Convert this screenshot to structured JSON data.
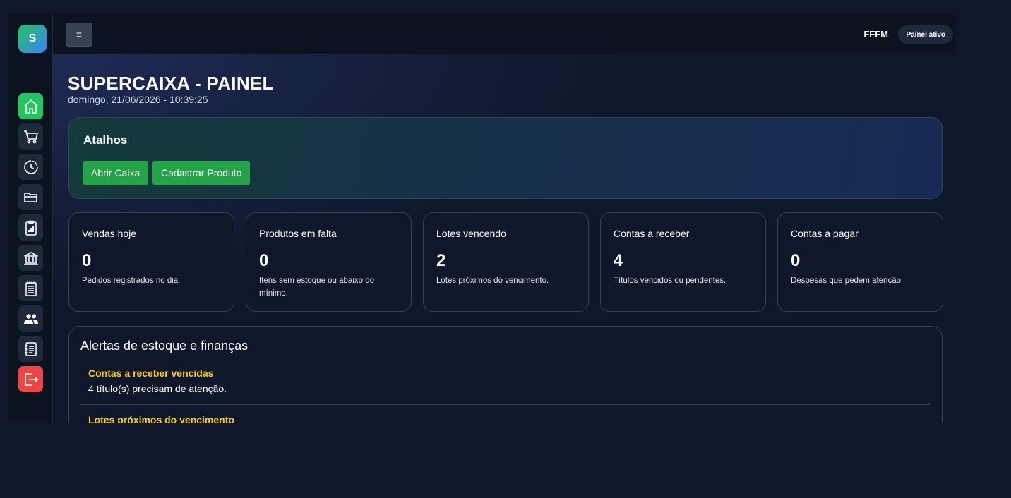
{
  "sidebar": {
    "logo_letter": "S",
    "items": [
      {
        "name": "home",
        "icon": "home-icon"
      },
      {
        "name": "cart",
        "icon": "cart-icon"
      },
      {
        "name": "history",
        "icon": "clock-icon"
      },
      {
        "name": "folder",
        "icon": "folder-icon"
      },
      {
        "name": "reports",
        "icon": "clipboard-chart-icon"
      },
      {
        "name": "bank",
        "icon": "bank-icon"
      },
      {
        "name": "notes",
        "icon": "notepad-icon"
      },
      {
        "name": "users",
        "icon": "users-icon"
      },
      {
        "name": "journal",
        "icon": "journal-icon"
      },
      {
        "name": "logout",
        "icon": "logout-icon"
      }
    ],
    "colors": {
      "active": "#22c55e",
      "logout": "#ef4444",
      "default": "#1e293b"
    }
  },
  "topbar": {
    "menu_icon": "≡",
    "user": "FFFM",
    "status": "Painel ativo"
  },
  "page": {
    "title": "SUPERCAIXA - PAINEL",
    "datetime": "domingo, 21/06/2026 - 10:39:25"
  },
  "shortcuts": {
    "title": "Atalhos",
    "open_cash_label": "Abrir Caixa",
    "register_product_label": "Cadastrar Produto"
  },
  "cards": [
    {
      "title": "Vendas hoje",
      "value": "0",
      "desc": "Pedidos registrados no dia."
    },
    {
      "title": "Produtos em falta",
      "value": "0",
      "desc": "Itens sem estoque ou abaixo do mínimo."
    },
    {
      "title": "Lotes vencendo",
      "value": "2",
      "desc": "Lotes próximos do vencimento."
    },
    {
      "title": "Contas a receber",
      "value": "4",
      "desc": "Títulos vencidos ou pendentes."
    },
    {
      "title": "Contas a pagar",
      "value": "0",
      "desc": "Despesas que pedem atenção."
    }
  ],
  "alerts": {
    "title": "Alertas de estoque e finanças",
    "items": [
      {
        "title": "Contas a receber vencidas",
        "text": "4 título(s) precisam de atenção."
      },
      {
        "title": "Lotes próximos do vencimento",
        "text": ""
      }
    ]
  }
}
